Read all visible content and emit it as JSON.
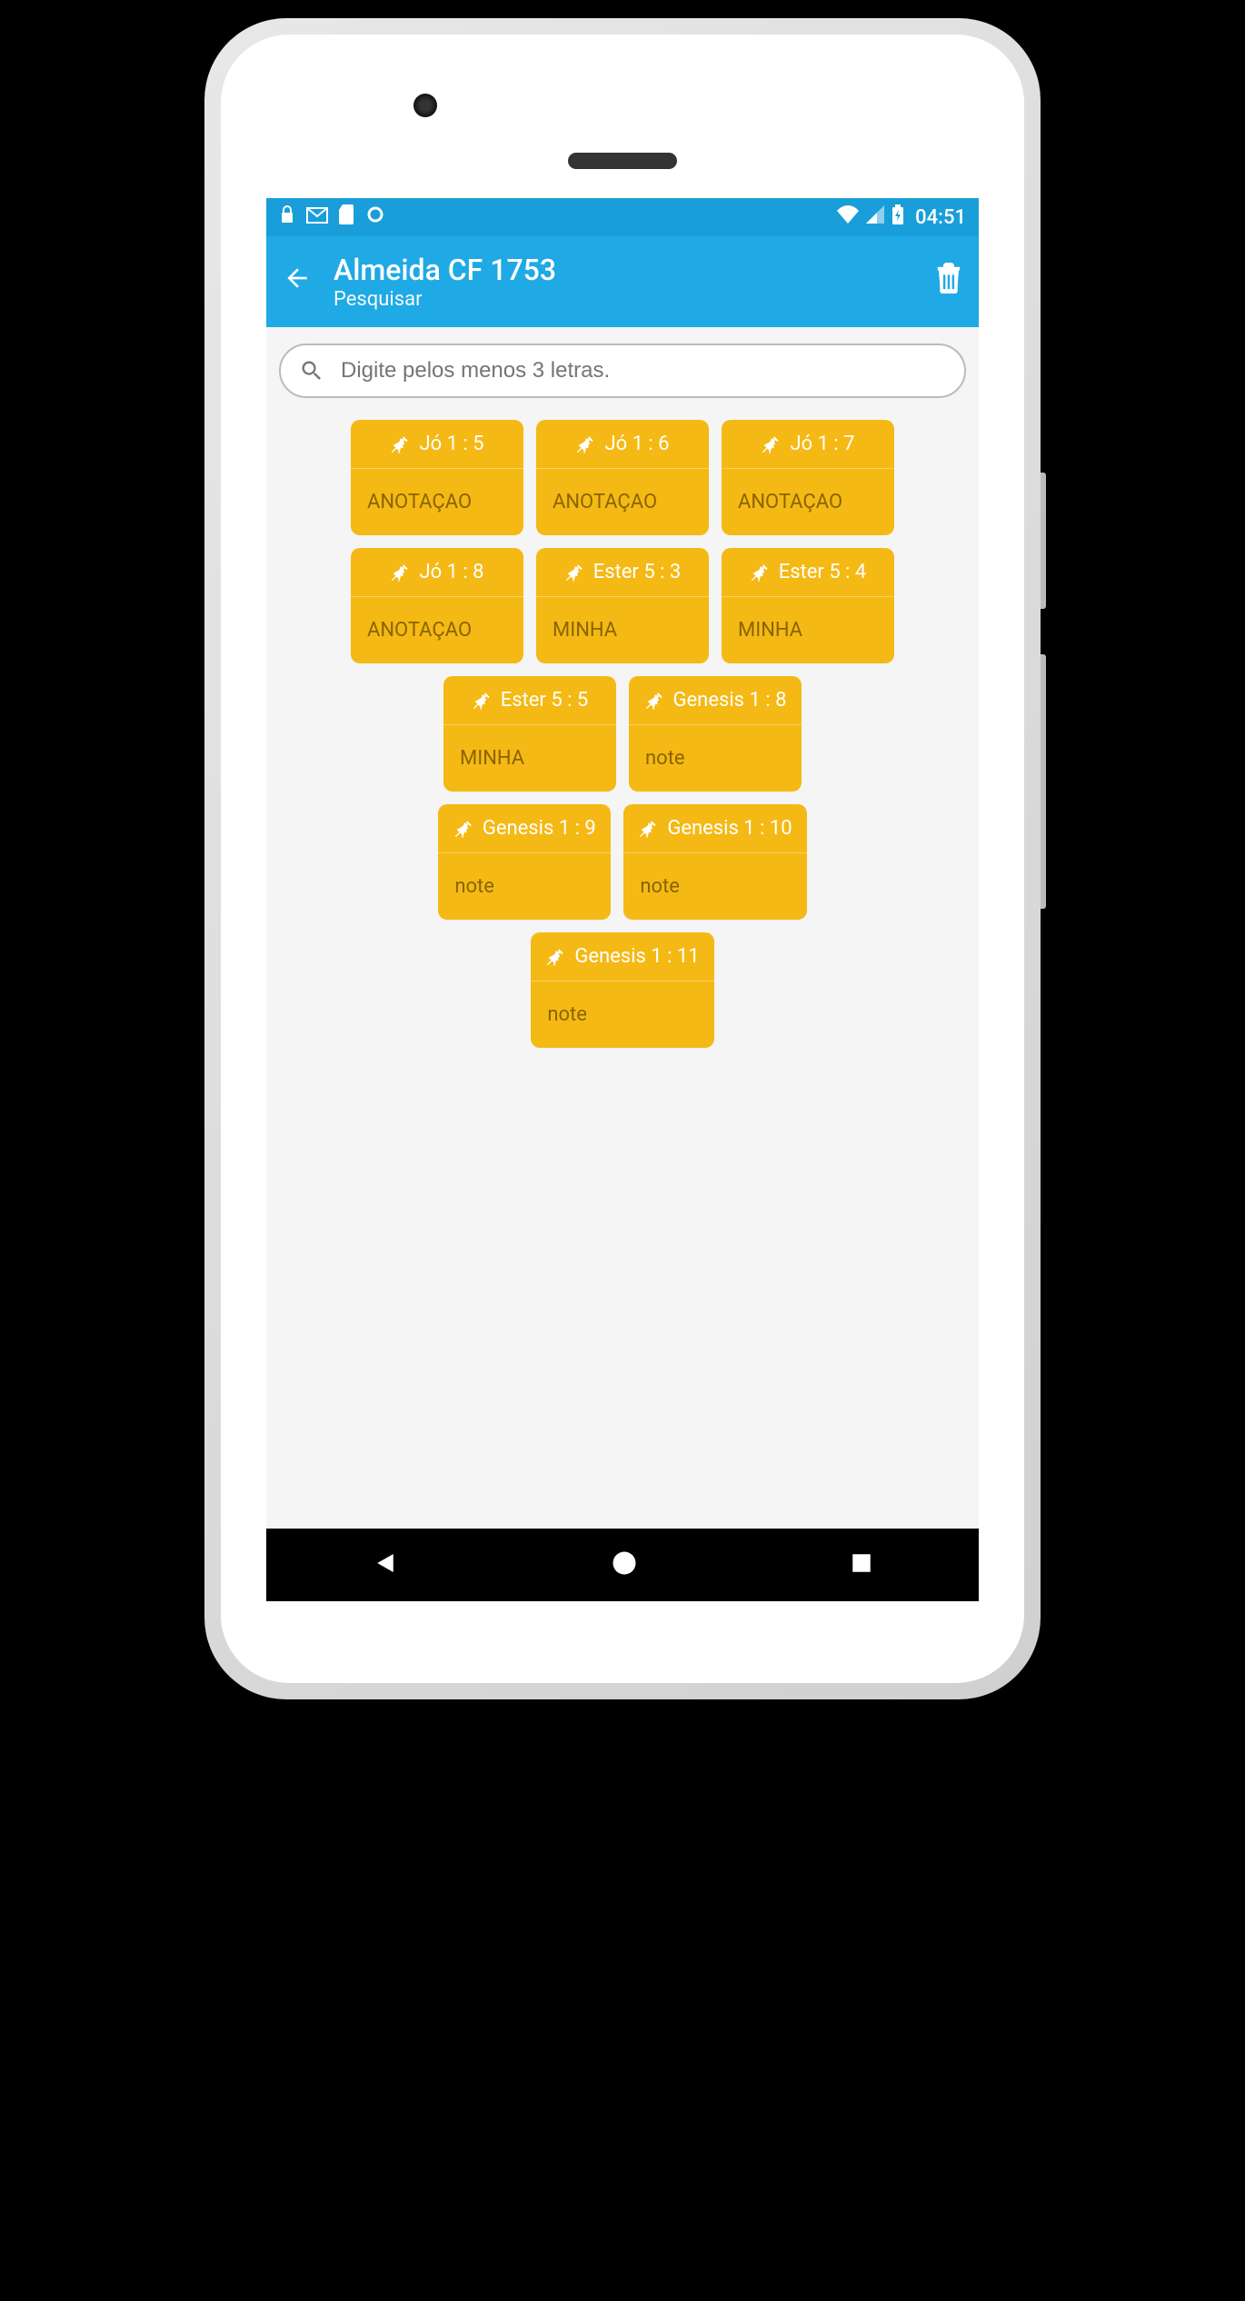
{
  "status": {
    "clock": "04:51"
  },
  "appbar": {
    "title": "Almeida CF 1753",
    "subtitle": "Pesquisar"
  },
  "search": {
    "placeholder": "Digite pelos menos 3 letras."
  },
  "rows": [
    [
      {
        "ref": "Jó 1 : 5",
        "note": "ANOTAÇAO"
      },
      {
        "ref": "Jó 1 : 6",
        "note": "ANOTAÇAO"
      },
      {
        "ref": "Jó 1 : 7",
        "note": "ANOTAÇAO"
      }
    ],
    [
      {
        "ref": "Jó 1 : 8",
        "note": "ANOTAÇAO"
      },
      {
        "ref": "Ester 5 : 3",
        "note": "MINHA"
      },
      {
        "ref": "Ester 5 : 4",
        "note": "MINHA"
      }
    ],
    [
      {
        "ref": "Ester 5 : 5",
        "note": "MINHA"
      },
      {
        "ref": "Genesis 1 : 8",
        "note": "note"
      }
    ],
    [
      {
        "ref": "Genesis 1 : 9",
        "note": "note"
      },
      {
        "ref": "Genesis 1 : 10",
        "note": "note"
      }
    ],
    [
      {
        "ref": "Genesis 1 : 11",
        "note": "note"
      }
    ]
  ],
  "colors": {
    "status_bg": "#1a9ed9",
    "appbar_bg": "#1fa9e5",
    "card_bg": "#f5b915",
    "card_text": "#8a6400"
  }
}
